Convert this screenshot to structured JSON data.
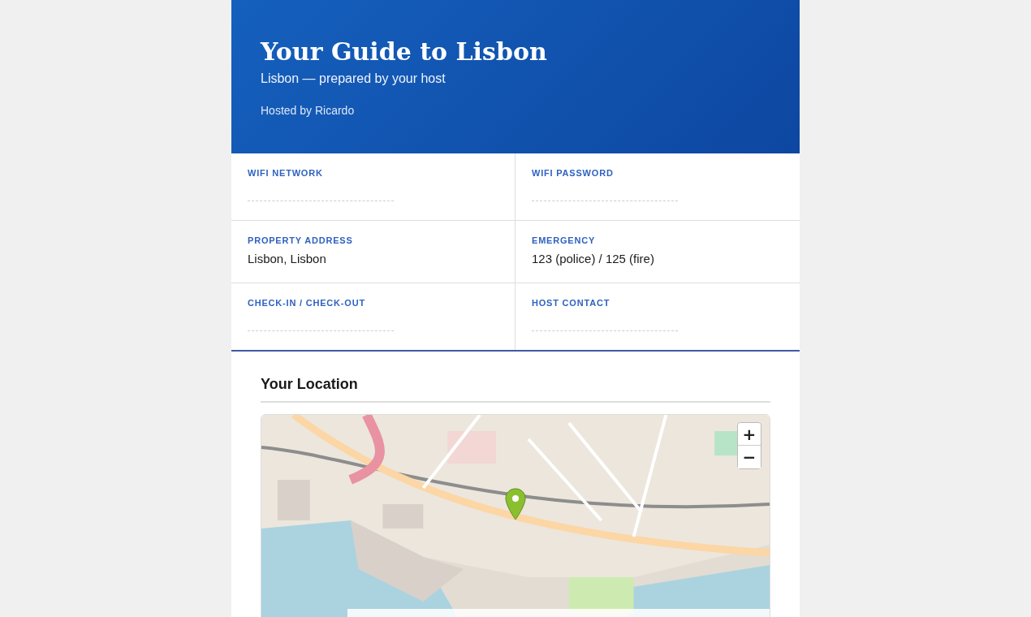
{
  "header": {
    "title": "Your Guide to Lisbon",
    "subtitle": "Lisbon — prepared by your host",
    "host": "Hosted by Ricardo"
  },
  "info": [
    {
      "label": "WIFI NETWORK"
    },
    {
      "label": "WIFI PASSWORD"
    },
    {
      "label": "PROPERTY ADDRESS",
      "value": "Lisbon, Lisbon"
    },
    {
      "label": "EMERGENCY",
      "value": "123 (police) / 125 (fire)"
    },
    {
      "label": "CHECK-IN / CHECK-OUT"
    },
    {
      "label": "HOST CONTACT"
    }
  ],
  "location": {
    "title": "Your Location",
    "zoom_in": "+",
    "zoom_out": "−"
  }
}
